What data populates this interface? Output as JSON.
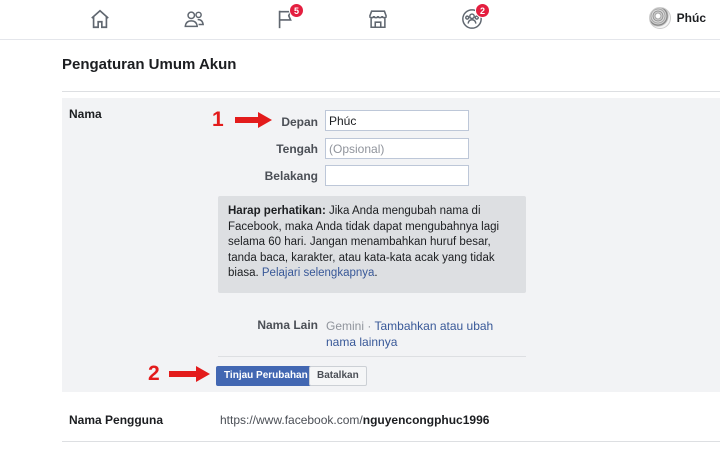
{
  "topbar": {
    "icons": {
      "home": "home-icon",
      "friends": "friends-icon",
      "pages": "flag-icon",
      "marketplace": "marketplace-icon",
      "groups": "groups-icon"
    },
    "pages_badge": "5",
    "groups_badge": "2",
    "profile_name": "Phúc"
  },
  "page": {
    "title": "Pengaturan Umum Akun"
  },
  "name_section": {
    "label": "Nama",
    "first_label": "Depan",
    "first_value": "Phúc",
    "middle_label": "Tengah",
    "middle_placeholder": "(Opsional)",
    "last_label": "Belakang",
    "last_value": "",
    "notice_bold": "Harap perhatikan:",
    "notice_text": " Jika Anda mengubah nama di Facebook, maka Anda tidak dapat mengubahnya lagi selama 60 hari. Jangan menambahkan huruf besar, tanda baca, karakter, atau kata-kata acak yang tidak biasa. ",
    "notice_link": "Pelajari selengkapnya",
    "notice_end": ".",
    "other_names_label": "Nama Lain",
    "other_names_value": "Gemini",
    "other_names_sep": " · ",
    "other_names_link": "Tambahkan atau ubah nama lainnya",
    "review_button": "Tinjau Perubahan",
    "cancel_button": "Batalkan"
  },
  "username_section": {
    "label": "Nama Pengguna",
    "url_prefix": "https://www.facebook.com/",
    "username": "nguyencongphuc1996"
  },
  "annotations": {
    "step1": "1",
    "step2": "2",
    "arrow_color": "#e31b1b"
  },
  "colors": {
    "accent": "#4267b2",
    "link": "#385898",
    "badge": "#e41e3f"
  }
}
